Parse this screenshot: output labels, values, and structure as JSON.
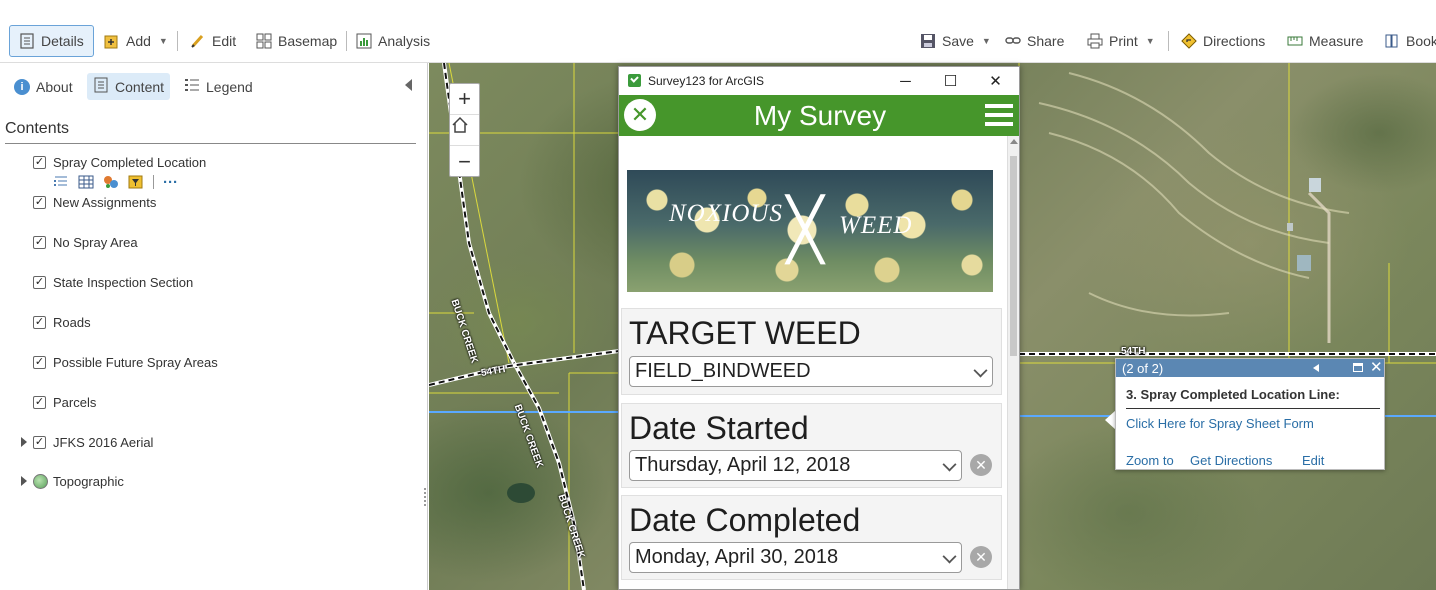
{
  "toolbar": {
    "details": "Details",
    "add": "Add",
    "edit": "Edit",
    "basemap": "Basemap",
    "analysis": "Analysis",
    "save": "Save",
    "share": "Share",
    "print": "Print",
    "directions": "Directions",
    "measure": "Measure",
    "bookmarks": "Book"
  },
  "left_panel": {
    "tabs": {
      "about": "About",
      "content": "Content",
      "legend": "Legend"
    },
    "contents_title": "Contents",
    "layers": [
      {
        "label": "Spray Completed Location",
        "checked": true
      },
      {
        "label": "New Assignments",
        "checked": true
      },
      {
        "label": "No Spray Area",
        "checked": true
      },
      {
        "label": "State Inspection Section",
        "checked": true
      },
      {
        "label": "Roads",
        "checked": true
      },
      {
        "label": "Possible Future Spray Areas",
        "checked": true
      },
      {
        "label": "Parcels",
        "checked": true
      },
      {
        "label": "JFKS 2016 Aerial",
        "checked": true,
        "expandable": true
      },
      {
        "label": "Topographic",
        "expandable": true,
        "icon": "globe-icon"
      }
    ],
    "more_label": "···"
  },
  "map": {
    "zoom_in": "+",
    "zoom_out": "−",
    "road_labels": {
      "buck_creek": "BUCK CREEK",
      "fifty_fourth": "54TH"
    }
  },
  "popup": {
    "counter": "(2 of 2)",
    "title": "3. Spray Completed Location Line:",
    "link": "Click Here for Spray Sheet Form",
    "zoom_to": "Zoom to",
    "get_directions": "Get Directions",
    "edit": "Edit"
  },
  "survey_window": {
    "app_title": "Survey123 for ArcGIS",
    "survey_title": "My Survey",
    "banner": {
      "word1": "NOXIOUS",
      "word2": "WEED"
    },
    "questions": [
      {
        "label": "TARGET WEED",
        "value": "FIELD_BINDWEED"
      },
      {
        "label": "Date Started",
        "value": "Thursday, April 12, 2018"
      },
      {
        "label": "Date Completed",
        "value": "Monday, April 30, 2018"
      }
    ],
    "accent_color": "#46962b"
  }
}
